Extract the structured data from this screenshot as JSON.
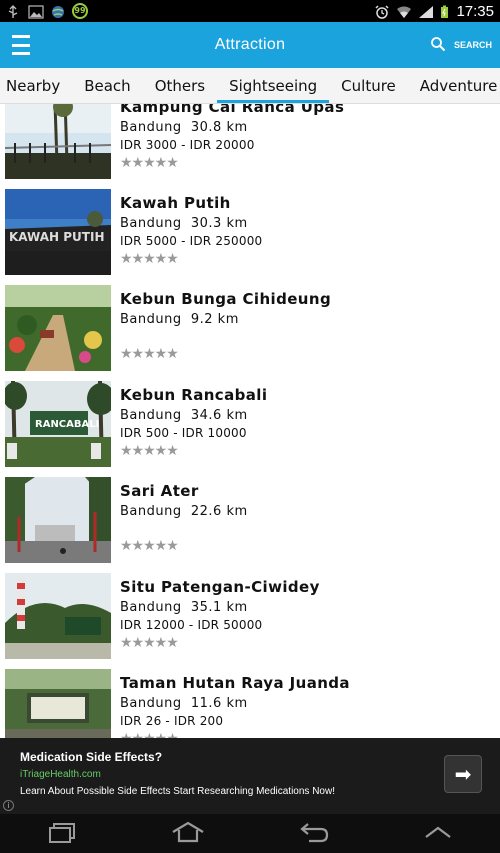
{
  "status_bar": {
    "notification_badge": "99",
    "time": "17:35"
  },
  "action_bar": {
    "title": "Attraction",
    "search_label": "SEARCH"
  },
  "tabs": [
    {
      "label": "Nearby",
      "active": false
    },
    {
      "label": "Beach",
      "active": false
    },
    {
      "label": "Others",
      "active": false
    },
    {
      "label": "Sightseeing",
      "active": true
    },
    {
      "label": "Culture",
      "active": false
    },
    {
      "label": "Adventure",
      "active": false
    }
  ],
  "attractions": [
    {
      "name": "Kampung Cai Ranca Upas",
      "city": "Bandung",
      "distance": "30.8 km",
      "price": "IDR 3000 - IDR 20000",
      "stars": "★★★★★"
    },
    {
      "name": "Kawah Putih",
      "city": "Bandung",
      "distance": "30.3 km",
      "price": "IDR 5000 - IDR 250000",
      "stars": "★★★★★"
    },
    {
      "name": "Kebun Bunga Cihideung",
      "city": "Bandung",
      "distance": "9.2 km",
      "price": "",
      "stars": "★★★★★"
    },
    {
      "name": "Kebun Rancabali",
      "city": "Bandung",
      "distance": "34.6 km",
      "price": "IDR 500 - IDR 10000",
      "stars": "★★★★★"
    },
    {
      "name": "Sari Ater",
      "city": "Bandung",
      "distance": "22.6 km",
      "price": "",
      "stars": "★★★★★"
    },
    {
      "name": "Situ Patengan-Ciwidey",
      "city": "Bandung",
      "distance": "35.1 km",
      "price": "IDR 12000 - IDR 50000",
      "stars": "★★★★★"
    },
    {
      "name": "Taman Hutan Raya Juanda",
      "city": "Bandung",
      "distance": "11.6 km",
      "price": "IDR 26 - IDR 200",
      "stars": "★★★★★"
    }
  ],
  "ad": {
    "title": "Medication Side Effects?",
    "url": "iTriageHealth.com",
    "description": "Learn About Possible Side Effects Start Researching Medications Now!",
    "arrow": "➡",
    "info": "i"
  },
  "colors": {
    "accent": "#1aa3dc",
    "ad_url": "#66cc66"
  }
}
